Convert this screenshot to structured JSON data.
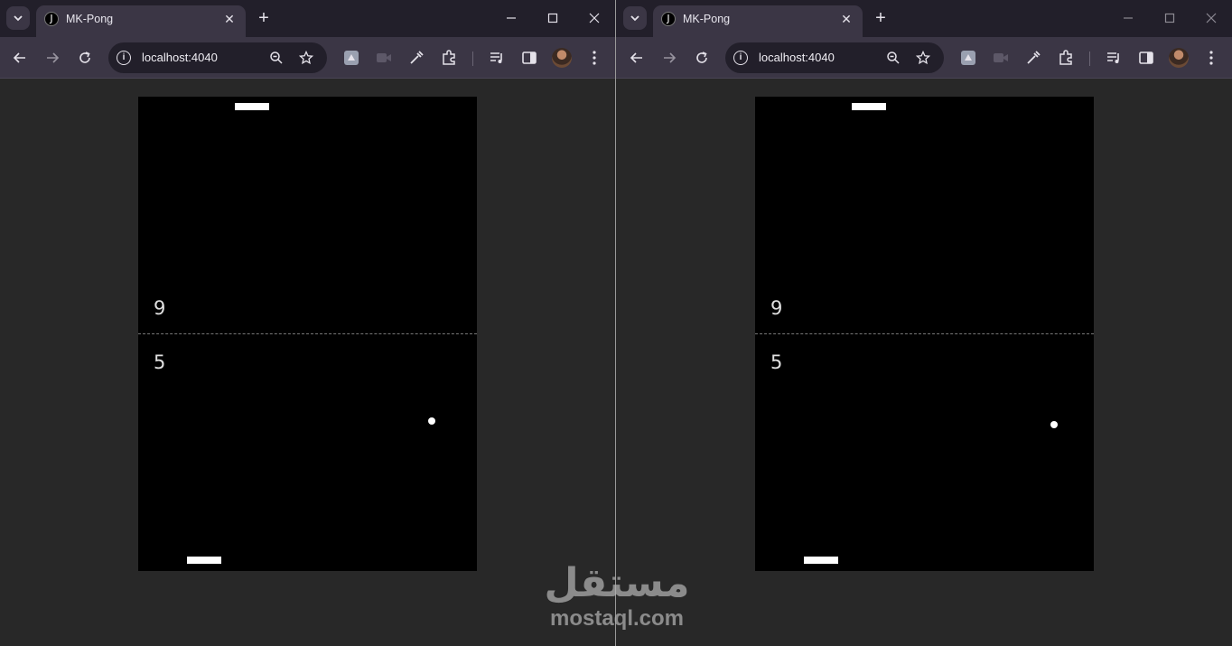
{
  "windows": [
    {
      "tab": {
        "favicon": "J",
        "title": "MK-Pong",
        "close": "✕"
      },
      "new_tab": "+",
      "controls": {
        "minimize": "—",
        "maximize": "☐",
        "close": "✕"
      },
      "address": {
        "url": "localhost:4040"
      },
      "game": {
        "score_top": "9",
        "score_bottom": "5"
      }
    },
    {
      "tab": {
        "favicon": "J",
        "title": "MK-Pong",
        "close": "✕"
      },
      "new_tab": "+",
      "controls": {
        "minimize": "—",
        "maximize": "☐",
        "close": "✕"
      },
      "address": {
        "url": "localhost:4040"
      },
      "game": {
        "score_top": "9",
        "score_bottom": "5"
      }
    }
  ],
  "watermark": {
    "arabic": "مستقل",
    "latin": "mostaql.com"
  },
  "icons": [
    "tab-search-icon",
    "back-icon",
    "forward-icon",
    "reload-icon",
    "info-icon",
    "zoom-icon",
    "star-icon",
    "eyedropper-icon",
    "extensions-icon",
    "media-icon",
    "sidepanel-icon",
    "menu-icon"
  ],
  "colors": {
    "tabstrip": "#221f2a",
    "toolbar": "#3b3645",
    "page_bg": "#282828",
    "game_bg": "#000000"
  }
}
